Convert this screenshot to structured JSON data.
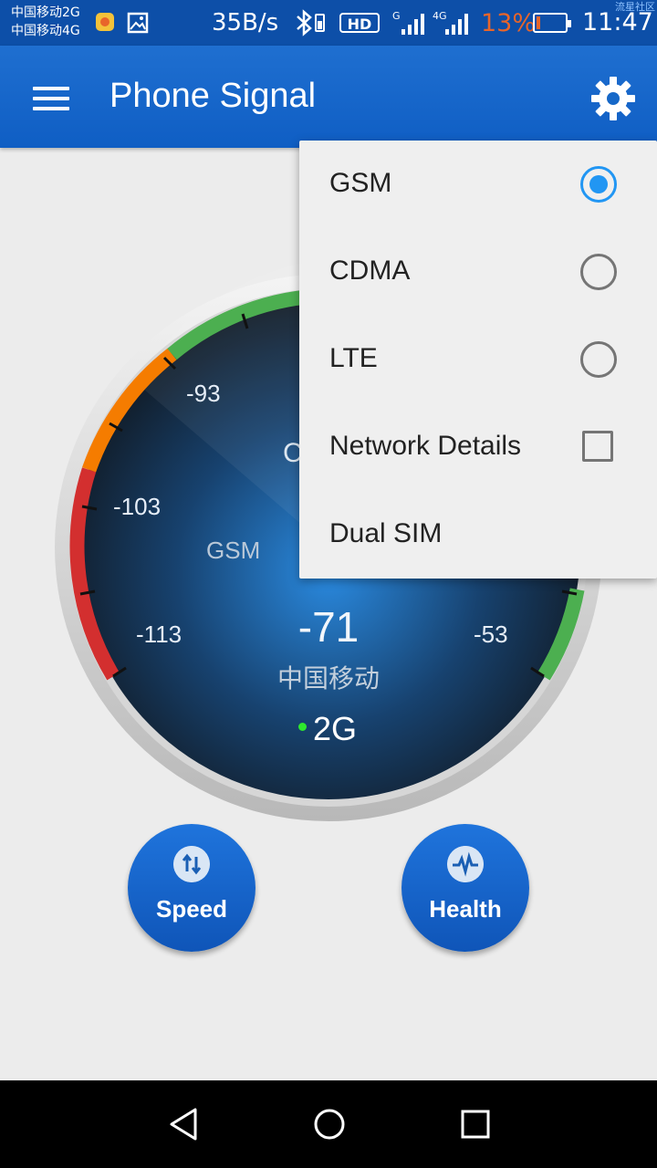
{
  "status_bar": {
    "carrier_1": "中国移动2G",
    "carrier_2": "中国移动4G",
    "net_speed": "35B/s",
    "hd_label": "HD",
    "sim1_type": "G",
    "sim2_type": "4G",
    "battery_percent": "13%",
    "battery_level": 0.13,
    "time": "11:47",
    "watermark": "流星社区"
  },
  "app_bar": {
    "title": "Phone Signal"
  },
  "gauge": {
    "scale_labels": {
      "minus_93": "-93",
      "minus_103": "-103",
      "minus_113": "-113",
      "minus_53": "-53"
    },
    "network_type": "GSM",
    "signal_dbm": "-71",
    "operator": "中国移动",
    "generation": "2G",
    "partial_label": "C"
  },
  "actions": {
    "speed_label": "Speed",
    "health_label": "Health"
  },
  "menu": {
    "items": [
      {
        "label": "GSM",
        "control": "radio",
        "checked": true
      },
      {
        "label": "CDMA",
        "control": "radio",
        "checked": false
      },
      {
        "label": "LTE",
        "control": "radio",
        "checked": false
      },
      {
        "label": "Network Details",
        "control": "checkbox",
        "checked": false
      },
      {
        "label": "Dual SIM",
        "control": "none",
        "checked": false
      }
    ]
  },
  "colors": {
    "app_bar": "#1565c0",
    "accent": "#2196f3",
    "gauge_red": "#d32f2f",
    "gauge_orange": "#f57c00",
    "gauge_green": "#4caf50"
  }
}
